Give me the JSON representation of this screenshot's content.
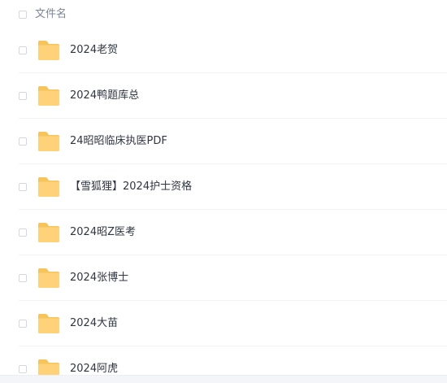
{
  "header": {
    "column_label": "文件名"
  },
  "files": [
    {
      "name": "2024老贺",
      "icon": "folder-icon"
    },
    {
      "name": "2024鸭题库总",
      "icon": "folder-icon"
    },
    {
      "name": "24昭昭临床执医PDF",
      "icon": "folder-icon"
    },
    {
      "name": "【雪狐狸】2024护士资格",
      "icon": "folder-icon"
    },
    {
      "name": "2024昭Z医考",
      "icon": "folder-icon"
    },
    {
      "name": "2024张博士",
      "icon": "folder-icon"
    },
    {
      "name": "2024大苗",
      "icon": "folder-icon"
    },
    {
      "name": "2024阿虎",
      "icon": "folder-icon"
    }
  ],
  "colors": {
    "folder": "#FFD27A",
    "folder_dark": "#F7C45C",
    "text": "#2f3542",
    "header_text": "#7c8494"
  }
}
